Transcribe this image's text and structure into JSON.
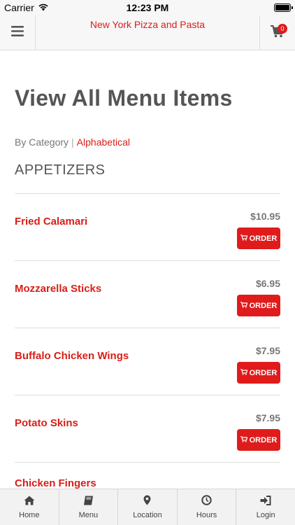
{
  "status_bar": {
    "carrier": "Carrier",
    "time": "12:23 PM"
  },
  "header": {
    "title": "New York Pizza and Pasta",
    "cart_count": "0"
  },
  "page": {
    "title": "View All Menu Items",
    "sort_by_category": "By Category",
    "sort_separator": "|",
    "sort_alphabetical": "Alphabetical",
    "category": "APPETIZERS"
  },
  "items": [
    {
      "name": "Fried Calamari",
      "price": "$10.95",
      "button": "ORDER"
    },
    {
      "name": "Mozzarella Sticks",
      "price": "$6.95",
      "button": "ORDER"
    },
    {
      "name": "Buffalo Chicken Wings",
      "price": "$7.95",
      "button": "ORDER"
    },
    {
      "name": "Potato Skins",
      "price": "$7.95",
      "button": "ORDER"
    },
    {
      "name": "Chicken Fingers",
      "price": "",
      "button": ""
    }
  ],
  "tabs": [
    {
      "label": "Home",
      "icon": "home-icon"
    },
    {
      "label": "Menu",
      "icon": "book-icon"
    },
    {
      "label": "Location",
      "icon": "map-pin-icon"
    },
    {
      "label": "Hours",
      "icon": "clock-icon"
    },
    {
      "label": "Login",
      "icon": "sign-in-icon"
    }
  ],
  "colors": {
    "brand_red": "#d91e18",
    "button_red": "#e01b1b",
    "title_gray": "#555555"
  }
}
